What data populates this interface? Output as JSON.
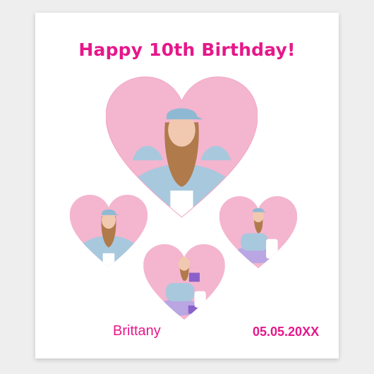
{
  "poster": {
    "title": "Happy 10th Birthday!",
    "name": "Brittany",
    "date": "05.05.20XX"
  },
  "photos": [
    {
      "id": "large",
      "description_icon": "girl-photo"
    },
    {
      "id": "left",
      "description_icon": "girl-photo"
    },
    {
      "id": "right",
      "description_icon": "girl-photo"
    },
    {
      "id": "bottom",
      "description_icon": "girl-photo"
    }
  ],
  "colors": {
    "accent": "#e6178a",
    "heart_pink": "#f4b5cf",
    "shirt_blue": "#a8c8de",
    "background": "#ffffff"
  }
}
